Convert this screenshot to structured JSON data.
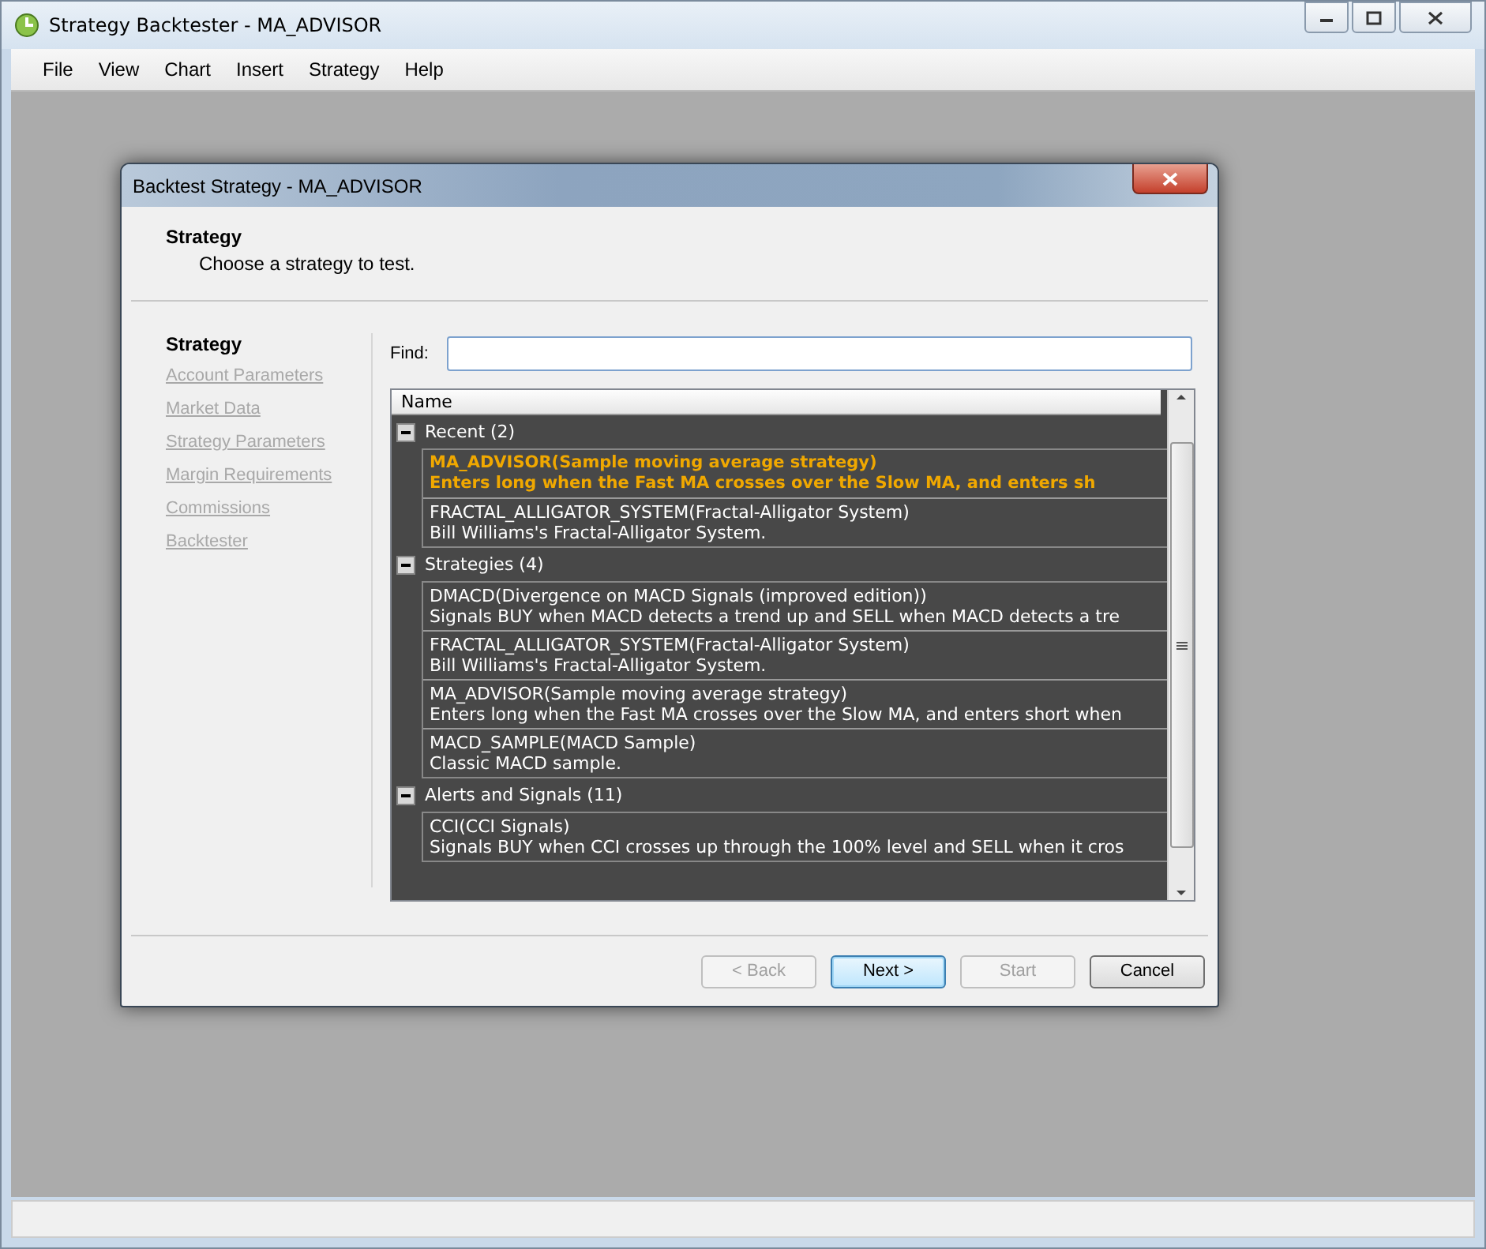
{
  "window": {
    "title": "Strategy Backtester - MA_ADVISOR"
  },
  "menu": [
    "File",
    "View",
    "Chart",
    "Insert",
    "Strategy",
    "Help"
  ],
  "dialog": {
    "title": "Backtest Strategy - MA_ADVISOR",
    "header": {
      "title": "Strategy",
      "subtitle": "Choose a strategy to test."
    },
    "steps": [
      {
        "label": "Strategy",
        "selected": true
      },
      {
        "label": "Account Parameters",
        "selected": false
      },
      {
        "label": "Market Data",
        "selected": false
      },
      {
        "label": "Strategy Parameters",
        "selected": false
      },
      {
        "label": "Margin Requirements",
        "selected": false
      },
      {
        "label": "Commissions",
        "selected": false
      },
      {
        "label": "Backtester",
        "selected": false
      }
    ],
    "find": {
      "label": "Find:"
    },
    "list": {
      "column": "Name",
      "groups": [
        {
          "label": "Recent (2)",
          "items": [
            {
              "name": "MA_ADVISOR(Sample moving average strategy)",
              "description": "Enters long when the Fast MA crosses over the Slow MA, and enters sh",
              "selected": true
            },
            {
              "name": "FRACTAL_ALLIGATOR_SYSTEM(Fractal-Alligator System)",
              "description": "Bill Williams's Fractal-Alligator System.",
              "selected": false
            }
          ]
        },
        {
          "label": "Strategies (4)",
          "items": [
            {
              "name": "DMACD(Divergence on MACD Signals (improved edition))",
              "description": "Signals BUY when MACD detects a trend up and SELL when MACD detects a tre",
              "selected": false
            },
            {
              "name": "FRACTAL_ALLIGATOR_SYSTEM(Fractal-Alligator System)",
              "description": "Bill Williams's Fractal-Alligator System.",
              "selected": false
            },
            {
              "name": "MA_ADVISOR(Sample moving average strategy)",
              "description": "Enters long when the Fast MA crosses over the Slow MA, and enters short when",
              "selected": false
            },
            {
              "name": "MACD_SAMPLE(MACD Sample)",
              "description": "Classic MACD sample.",
              "selected": false
            }
          ]
        },
        {
          "label": "Alerts and Signals (11)",
          "items": [
            {
              "name": "CCI(CCI Signals)",
              "description": "Signals BUY when CCI crosses up through the 100% level and SELL when it cros",
              "selected": false
            }
          ]
        }
      ]
    },
    "buttons": [
      {
        "label": "< Back",
        "disabled": true,
        "default": false
      },
      {
        "label": "Next >",
        "disabled": false,
        "default": true
      },
      {
        "label": "Start",
        "disabled": true,
        "default": false
      },
      {
        "label": "Cancel",
        "disabled": false,
        "default": false
      }
    ]
  }
}
